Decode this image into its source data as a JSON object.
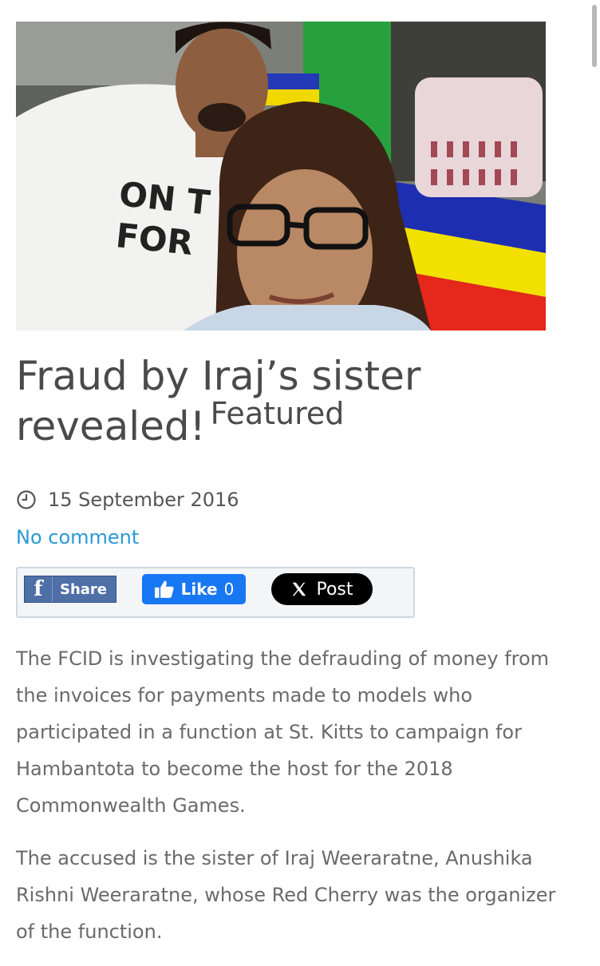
{
  "article": {
    "hero_image": {
      "alt": "Selfie of a man in a white t-shirt and a woman with glasses"
    },
    "title": "Fraud by Iraj’s sister revealed!",
    "featured_label": "Featured",
    "date": "15 September 2016",
    "comments_link": "No comment",
    "share": {
      "facebook_label": "Share",
      "like_label": "Like",
      "like_count": "0",
      "x_label": "Post"
    },
    "paragraphs": [
      "The FCID is investigating the defrauding of money from the invoices for payments made to models who participated in a function at St. Kitts to campaign for Hambantota to become the host for the 2018 Commonwealth Games.",
      "The accused is the sister of Iraj Weeraratne, Anushika Rishni Weeraratne, whose Red Cherry was the organizer of the function."
    ]
  },
  "icons": [
    "clock-icon",
    "facebook-icon",
    "thumbs-up-icon",
    "x-logo-icon"
  ],
  "colors": {
    "link": "#2a9ad6",
    "title": "#4a4a4a",
    "body_text": "#6a6a6a",
    "facebook": "#4f6fa7",
    "like": "#1877f2",
    "x": "#000000"
  }
}
